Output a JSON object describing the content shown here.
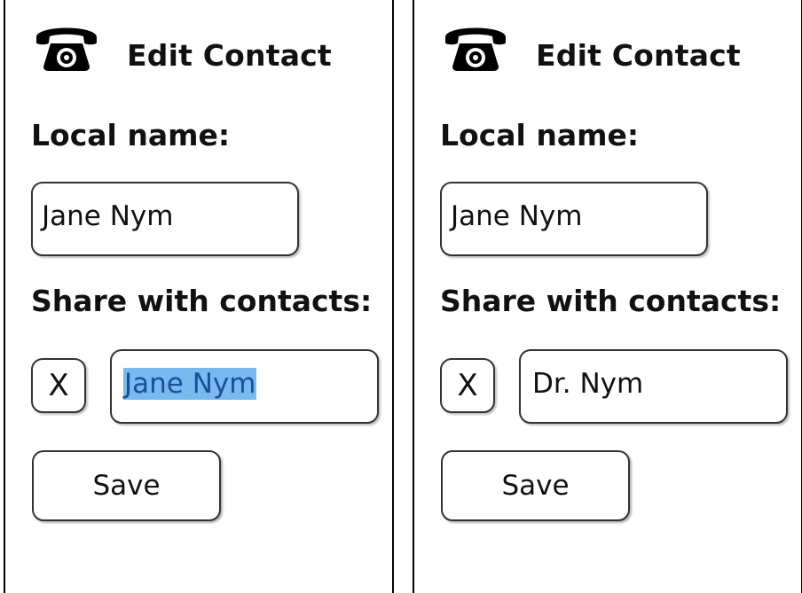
{
  "panels": [
    {
      "title": "Edit Contact",
      "icon": "telephone-icon",
      "local_name_label": "Local name:",
      "local_name_value": "Jane Nym",
      "share_label": "Share with contacts:",
      "x_button_label": "X",
      "share_value": "Jane Nym",
      "share_value_selected": true,
      "save_label": "Save"
    },
    {
      "title": "Edit Contact",
      "icon": "telephone-icon",
      "local_name_label": "Local name:",
      "local_name_value": "Jane Nym",
      "share_label": "Share with contacts:",
      "x_button_label": "X",
      "share_value": "Dr. Nym",
      "share_value_selected": false,
      "save_label": "Save"
    }
  ],
  "colors": {
    "selection_background": "#7ab8f0",
    "selection_text": "#1a4f9a",
    "border": "#333333"
  }
}
